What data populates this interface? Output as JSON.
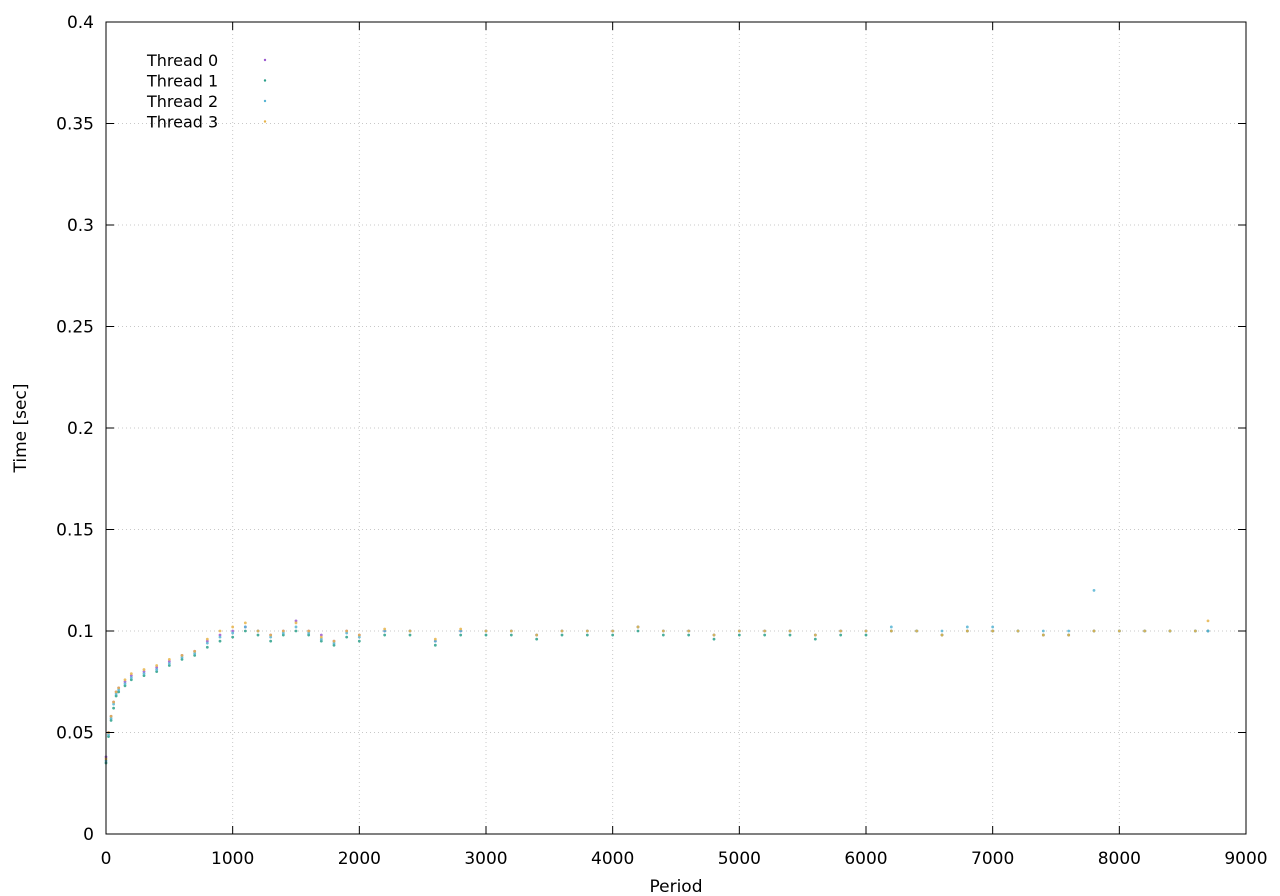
{
  "chart_data": {
    "type": "scatter",
    "xlabel": "Period",
    "ylabel": "Time [sec]",
    "xlim": [
      0,
      9000
    ],
    "ylim": [
      0,
      0.4
    ],
    "xticks": [
      0,
      1000,
      2000,
      3000,
      4000,
      5000,
      6000,
      7000,
      8000,
      9000
    ],
    "yticks": [
      0,
      0.05,
      0.1,
      0.15,
      0.2,
      0.25,
      0.3,
      0.35,
      0.4
    ],
    "xtick_labels": [
      "0",
      "1000",
      "2000",
      "3000",
      "4000",
      "5000",
      "6000",
      "7000",
      "8000",
      "9000"
    ],
    "ytick_labels": [
      "0",
      "0.05",
      "0.1",
      "0.15",
      "0.2",
      "0.25",
      "0.3",
      "0.35",
      "0.4"
    ],
    "grid": true,
    "legend_position": "top-left",
    "series": [
      {
        "name": "Thread 0",
        "color": "#9b59d0",
        "x": [
          0,
          20,
          40,
          60,
          80,
          100,
          150,
          200,
          300,
          400,
          500,
          600,
          700,
          800,
          900,
          1000,
          1100,
          1200,
          1300,
          1400,
          1500,
          1600,
          1700,
          1800,
          1900,
          2000,
          2200,
          2400,
          2600,
          2800,
          3000,
          3200,
          3400,
          3600,
          3800,
          4000,
          4200,
          4400,
          4600,
          4800,
          5000,
          5200,
          5400,
          5600,
          5800,
          6000,
          6200,
          6400,
          6600,
          6800,
          7000,
          7200,
          7400,
          7600,
          7800,
          8000,
          8200,
          8400,
          8600,
          8700
        ],
        "y": [
          0.038,
          0.05,
          0.058,
          0.065,
          0.07,
          0.072,
          0.075,
          0.078,
          0.08,
          0.082,
          0.085,
          0.088,
          0.09,
          0.095,
          0.098,
          0.1,
          0.102,
          0.1,
          0.098,
          0.1,
          0.105,
          0.1,
          0.098,
          0.095,
          0.1,
          0.098,
          0.1,
          0.1,
          0.095,
          0.1,
          0.1,
          0.1,
          0.098,
          0.1,
          0.1,
          0.1,
          0.102,
          0.1,
          0.1,
          0.098,
          0.1,
          0.1,
          0.1,
          0.098,
          0.1,
          0.1,
          0.1,
          0.1,
          0.098,
          0.1,
          0.1,
          0.1,
          0.098,
          0.098,
          0.1,
          0.1,
          0.1,
          0.1,
          0.1,
          0.1
        ]
      },
      {
        "name": "Thread 1",
        "color": "#2aa08a",
        "x": [
          0,
          20,
          40,
          60,
          80,
          100,
          150,
          200,
          300,
          400,
          500,
          600,
          700,
          800,
          900,
          1000,
          1100,
          1200,
          1300,
          1400,
          1500,
          1600,
          1700,
          1800,
          1900,
          2000,
          2200,
          2400,
          2600,
          2800,
          3000,
          3200,
          3400,
          3600,
          3800,
          4000,
          4200,
          4400,
          4600,
          4800,
          5000,
          5200,
          5400,
          5600,
          5800,
          6000,
          6200,
          6400,
          6600,
          6800,
          7000,
          7200,
          7400,
          7600,
          7800,
          8000,
          8200,
          8400,
          8600,
          8700
        ],
        "y": [
          0.035,
          0.048,
          0.056,
          0.062,
          0.068,
          0.07,
          0.073,
          0.076,
          0.078,
          0.08,
          0.083,
          0.086,
          0.088,
          0.092,
          0.095,
          0.097,
          0.1,
          0.098,
          0.095,
          0.098,
          0.1,
          0.098,
          0.095,
          0.093,
          0.097,
          0.095,
          0.098,
          0.098,
          0.093,
          0.098,
          0.098,
          0.098,
          0.096,
          0.098,
          0.098,
          0.098,
          0.1,
          0.098,
          0.098,
          0.096,
          0.098,
          0.098,
          0.098,
          0.096,
          0.098,
          0.098,
          0.1,
          0.1,
          0.098,
          0.1,
          0.1,
          0.1,
          0.098,
          0.098,
          0.1,
          0.1,
          0.1,
          0.1,
          0.1,
          0.1
        ]
      },
      {
        "name": "Thread 2",
        "color": "#56b4d3",
        "x": [
          0,
          20,
          40,
          60,
          80,
          100,
          150,
          200,
          300,
          400,
          500,
          600,
          700,
          800,
          900,
          1000,
          1100,
          1200,
          1300,
          1400,
          1500,
          1600,
          1700,
          1800,
          1900,
          2000,
          2200,
          2400,
          2600,
          2800,
          3000,
          3200,
          3400,
          3600,
          3800,
          4000,
          4200,
          4400,
          4600,
          4800,
          5000,
          5200,
          5400,
          5600,
          5800,
          6000,
          6200,
          6400,
          6600,
          6800,
          7000,
          7200,
          7400,
          7600,
          7800,
          8000,
          8200,
          8400,
          8600,
          8700
        ],
        "y": [
          0.036,
          0.049,
          0.057,
          0.064,
          0.069,
          0.071,
          0.074,
          0.077,
          0.079,
          0.081,
          0.084,
          0.087,
          0.089,
          0.094,
          0.097,
          0.099,
          0.102,
          0.1,
          0.097,
          0.099,
          0.102,
          0.099,
          0.096,
          0.094,
          0.099,
          0.097,
          0.1,
          0.1,
          0.095,
          0.1,
          0.1,
          0.1,
          0.098,
          0.1,
          0.1,
          0.1,
          0.102,
          0.1,
          0.1,
          0.098,
          0.1,
          0.1,
          0.1,
          0.098,
          0.1,
          0.1,
          0.102,
          0.1,
          0.1,
          0.102,
          0.102,
          0.1,
          0.1,
          0.1,
          0.12,
          0.1,
          0.1,
          0.1,
          0.1,
          0.1
        ]
      },
      {
        "name": "Thread 3",
        "color": "#e6b44a",
        "x": [
          0,
          20,
          40,
          60,
          80,
          100,
          150,
          200,
          300,
          400,
          500,
          600,
          700,
          800,
          900,
          1000,
          1100,
          1200,
          1300,
          1400,
          1500,
          1600,
          1700,
          1800,
          1900,
          2000,
          2200,
          2400,
          2600,
          2800,
          3000,
          3200,
          3400,
          3600,
          3800,
          4000,
          4200,
          4400,
          4600,
          4800,
          5000,
          5200,
          5400,
          5600,
          5800,
          6000,
          6200,
          6400,
          6600,
          6800,
          7000,
          7200,
          7400,
          7600,
          7800,
          8000,
          8200,
          8400,
          8600,
          8700
        ],
        "y": [
          0.037,
          0.05,
          0.058,
          0.065,
          0.07,
          0.072,
          0.076,
          0.079,
          0.081,
          0.083,
          0.086,
          0.088,
          0.09,
          0.096,
          0.1,
          0.102,
          0.104,
          0.1,
          0.098,
          0.1,
          0.104,
          0.1,
          0.097,
          0.095,
          0.1,
          0.098,
          0.101,
          0.1,
          0.096,
          0.101,
          0.1,
          0.1,
          0.098,
          0.1,
          0.1,
          0.1,
          0.102,
          0.1,
          0.1,
          0.098,
          0.1,
          0.1,
          0.1,
          0.098,
          0.1,
          0.1,
          0.1,
          0.1,
          0.098,
          0.1,
          0.1,
          0.1,
          0.098,
          0.098,
          0.1,
          0.1,
          0.1,
          0.1,
          0.1,
          0.105
        ]
      }
    ]
  }
}
